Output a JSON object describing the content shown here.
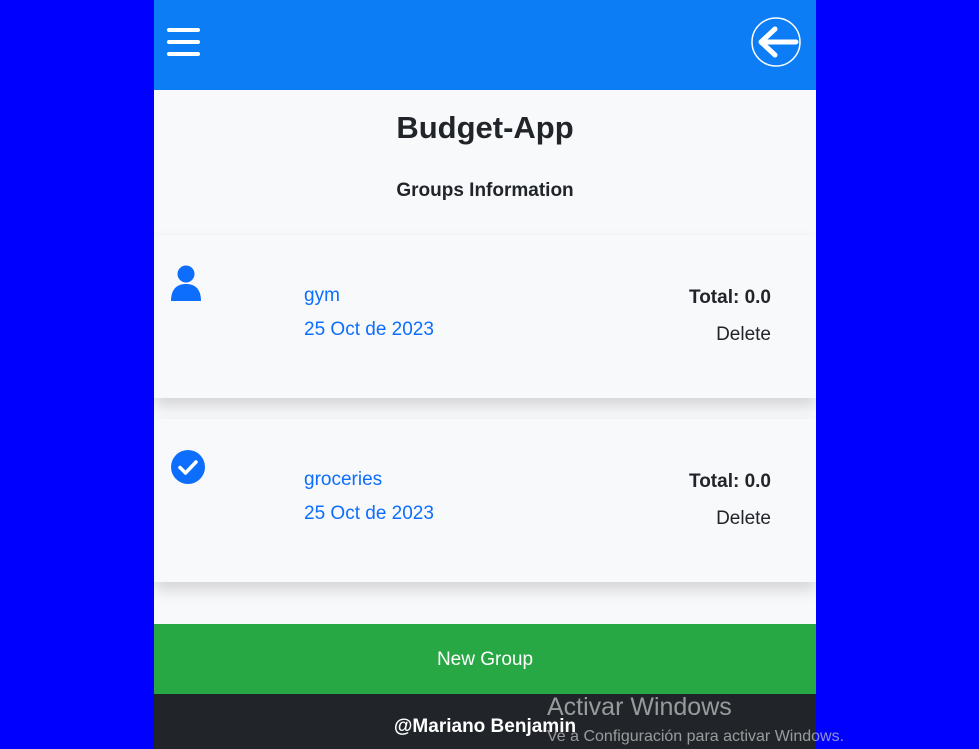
{
  "app": {
    "title": "Budget-App",
    "subtitle": "Groups Information",
    "colors": {
      "header": "#0d7df5",
      "link": "#0d6efd",
      "success": "#28a745",
      "footer": "#212529",
      "page_background": "#0000ff"
    }
  },
  "header": {
    "menu_icon": "hamburger-menu-icon",
    "back_icon": "arrow-left-circle-icon"
  },
  "groups": [
    {
      "icon": "user-icon",
      "name": "gym",
      "date": "25 Oct de 2023",
      "total": "Total: 0.0",
      "delete_label": "Delete"
    },
    {
      "icon": "check-circle-icon",
      "name": "groceries",
      "date": "25 Oct de 2023",
      "total": "Total: 0.0",
      "delete_label": "Delete"
    }
  ],
  "new_group_label": "New Group",
  "footer": {
    "text": "@Mariano Benjamin"
  },
  "watermark": {
    "title": "Activar Windows",
    "subtitle": "Ve a Configuración para activar Windows."
  }
}
